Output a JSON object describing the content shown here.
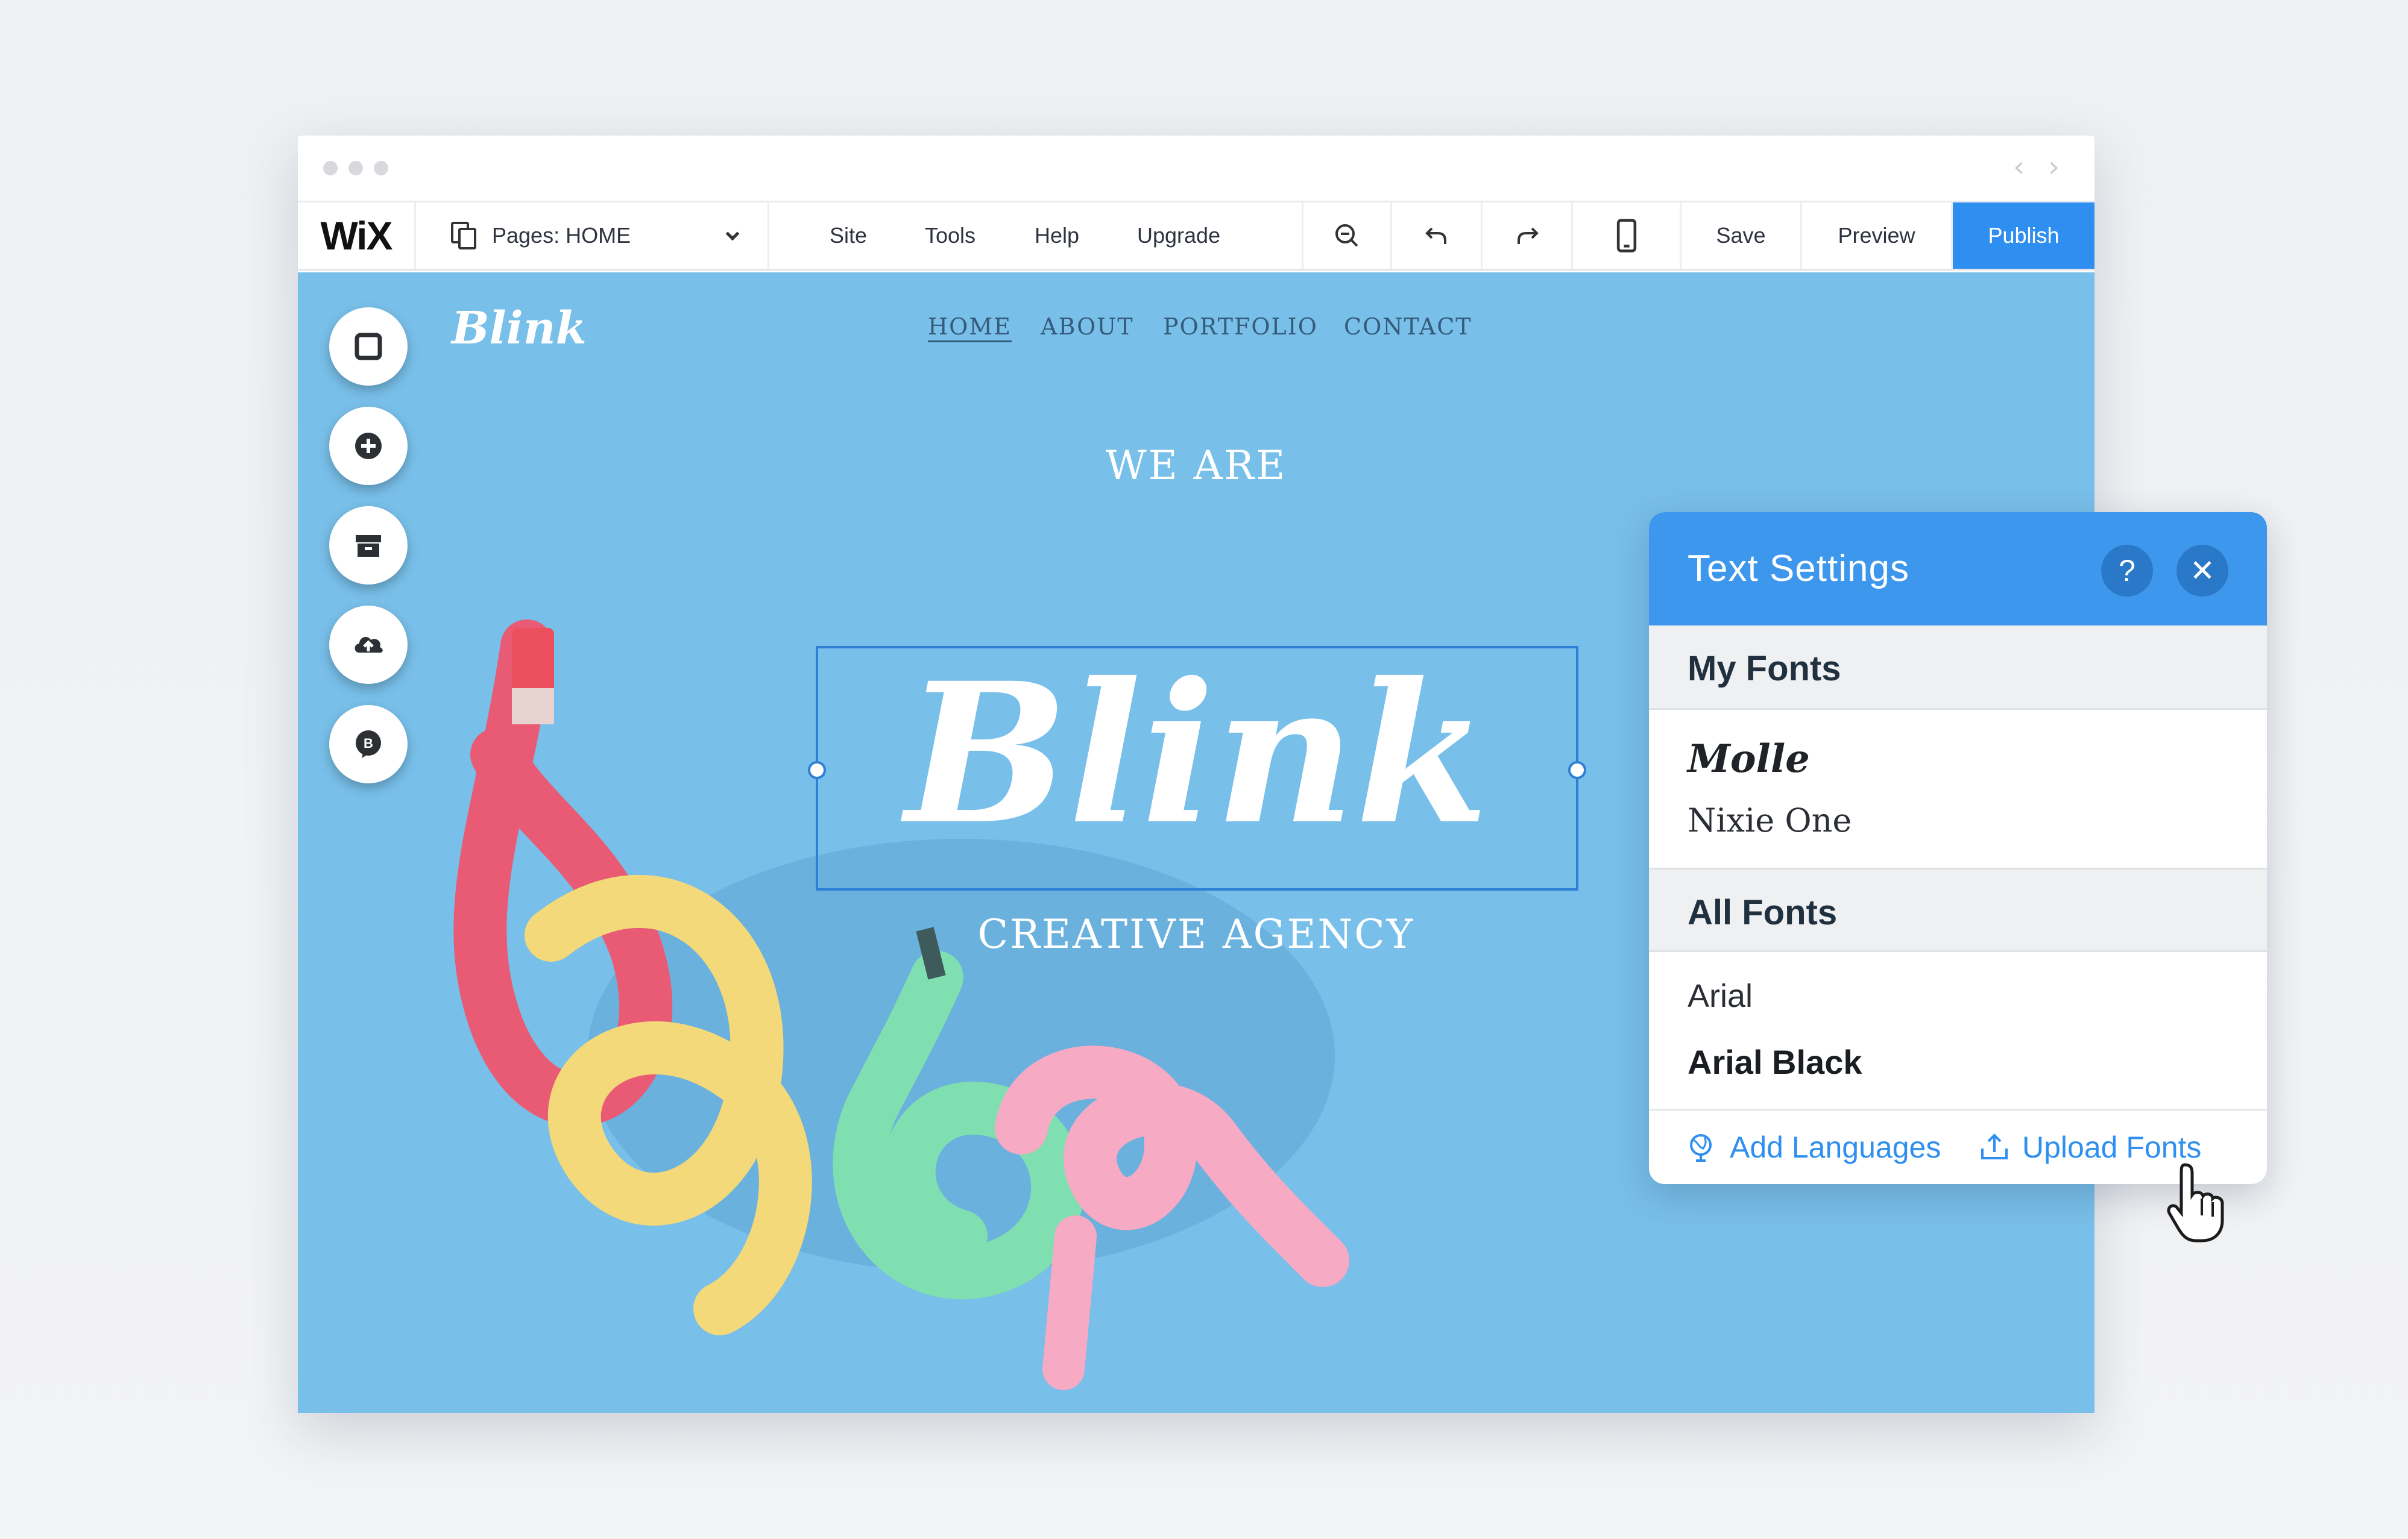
{
  "editor": {
    "logo": "WiX",
    "pages_label": "Pages: HOME",
    "menu": [
      "Site",
      "Tools",
      "Help",
      "Upgrade"
    ],
    "save": "Save",
    "preview": "Preview",
    "publish": "Publish",
    "accent_color": "#2f8ff0"
  },
  "site": {
    "logo": "Blink",
    "nav": [
      "HOME",
      "ABOUT",
      "PORTFOLIO",
      "CONTACT"
    ],
    "active_nav": "HOME",
    "kicker": "WE ARE",
    "title": "Blink",
    "subtitle": "CREATIVE AGENCY",
    "background_color": "#78bfe9"
  },
  "left_tools": [
    "background-icon",
    "add-icon",
    "store-icon",
    "upload-icon",
    "blog-icon"
  ],
  "text_settings": {
    "title": "Text Settings",
    "help_icon": "?",
    "close_icon": "✕",
    "my_fonts_heading": "My Fonts",
    "my_fonts": [
      "Molle",
      "Nixie One"
    ],
    "all_fonts_heading": "All Fonts",
    "all_fonts": [
      "Arial",
      "Arial Black"
    ],
    "add_languages": "Add Languages",
    "upload_fonts": "Upload Fonts"
  }
}
